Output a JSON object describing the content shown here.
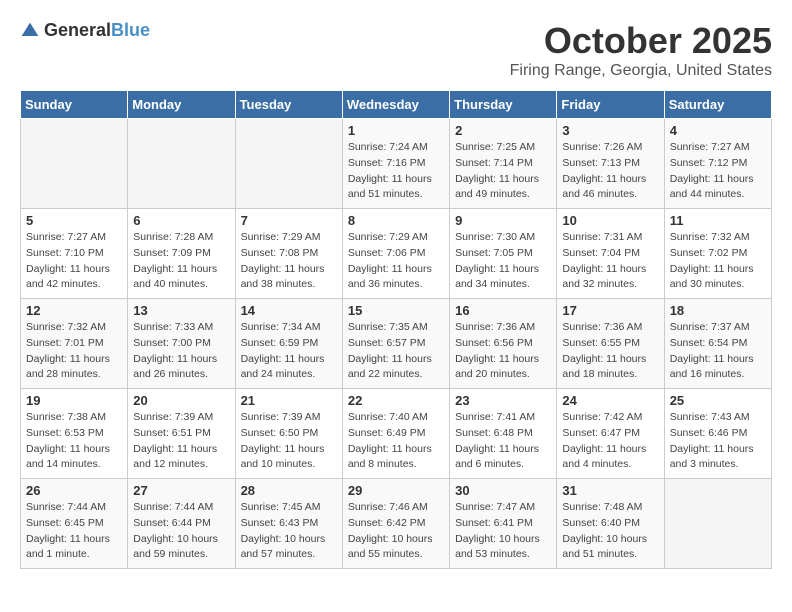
{
  "logo": {
    "general": "General",
    "blue": "Blue"
  },
  "header": {
    "month": "October 2025",
    "location": "Firing Range, Georgia, United States"
  },
  "weekdays": [
    "Sunday",
    "Monday",
    "Tuesday",
    "Wednesday",
    "Thursday",
    "Friday",
    "Saturday"
  ],
  "weeks": [
    [
      {
        "day": "",
        "sunrise": "",
        "sunset": "",
        "daylight": ""
      },
      {
        "day": "",
        "sunrise": "",
        "sunset": "",
        "daylight": ""
      },
      {
        "day": "",
        "sunrise": "",
        "sunset": "",
        "daylight": ""
      },
      {
        "day": "1",
        "sunrise": "Sunrise: 7:24 AM",
        "sunset": "Sunset: 7:16 PM",
        "daylight": "Daylight: 11 hours and 51 minutes."
      },
      {
        "day": "2",
        "sunrise": "Sunrise: 7:25 AM",
        "sunset": "Sunset: 7:14 PM",
        "daylight": "Daylight: 11 hours and 49 minutes."
      },
      {
        "day": "3",
        "sunrise": "Sunrise: 7:26 AM",
        "sunset": "Sunset: 7:13 PM",
        "daylight": "Daylight: 11 hours and 46 minutes."
      },
      {
        "day": "4",
        "sunrise": "Sunrise: 7:27 AM",
        "sunset": "Sunset: 7:12 PM",
        "daylight": "Daylight: 11 hours and 44 minutes."
      }
    ],
    [
      {
        "day": "5",
        "sunrise": "Sunrise: 7:27 AM",
        "sunset": "Sunset: 7:10 PM",
        "daylight": "Daylight: 11 hours and 42 minutes."
      },
      {
        "day": "6",
        "sunrise": "Sunrise: 7:28 AM",
        "sunset": "Sunset: 7:09 PM",
        "daylight": "Daylight: 11 hours and 40 minutes."
      },
      {
        "day": "7",
        "sunrise": "Sunrise: 7:29 AM",
        "sunset": "Sunset: 7:08 PM",
        "daylight": "Daylight: 11 hours and 38 minutes."
      },
      {
        "day": "8",
        "sunrise": "Sunrise: 7:29 AM",
        "sunset": "Sunset: 7:06 PM",
        "daylight": "Daylight: 11 hours and 36 minutes."
      },
      {
        "day": "9",
        "sunrise": "Sunrise: 7:30 AM",
        "sunset": "Sunset: 7:05 PM",
        "daylight": "Daylight: 11 hours and 34 minutes."
      },
      {
        "day": "10",
        "sunrise": "Sunrise: 7:31 AM",
        "sunset": "Sunset: 7:04 PM",
        "daylight": "Daylight: 11 hours and 32 minutes."
      },
      {
        "day": "11",
        "sunrise": "Sunrise: 7:32 AM",
        "sunset": "Sunset: 7:02 PM",
        "daylight": "Daylight: 11 hours and 30 minutes."
      }
    ],
    [
      {
        "day": "12",
        "sunrise": "Sunrise: 7:32 AM",
        "sunset": "Sunset: 7:01 PM",
        "daylight": "Daylight: 11 hours and 28 minutes."
      },
      {
        "day": "13",
        "sunrise": "Sunrise: 7:33 AM",
        "sunset": "Sunset: 7:00 PM",
        "daylight": "Daylight: 11 hours and 26 minutes."
      },
      {
        "day": "14",
        "sunrise": "Sunrise: 7:34 AM",
        "sunset": "Sunset: 6:59 PM",
        "daylight": "Daylight: 11 hours and 24 minutes."
      },
      {
        "day": "15",
        "sunrise": "Sunrise: 7:35 AM",
        "sunset": "Sunset: 6:57 PM",
        "daylight": "Daylight: 11 hours and 22 minutes."
      },
      {
        "day": "16",
        "sunrise": "Sunrise: 7:36 AM",
        "sunset": "Sunset: 6:56 PM",
        "daylight": "Daylight: 11 hours and 20 minutes."
      },
      {
        "day": "17",
        "sunrise": "Sunrise: 7:36 AM",
        "sunset": "Sunset: 6:55 PM",
        "daylight": "Daylight: 11 hours and 18 minutes."
      },
      {
        "day": "18",
        "sunrise": "Sunrise: 7:37 AM",
        "sunset": "Sunset: 6:54 PM",
        "daylight": "Daylight: 11 hours and 16 minutes."
      }
    ],
    [
      {
        "day": "19",
        "sunrise": "Sunrise: 7:38 AM",
        "sunset": "Sunset: 6:53 PM",
        "daylight": "Daylight: 11 hours and 14 minutes."
      },
      {
        "day": "20",
        "sunrise": "Sunrise: 7:39 AM",
        "sunset": "Sunset: 6:51 PM",
        "daylight": "Daylight: 11 hours and 12 minutes."
      },
      {
        "day": "21",
        "sunrise": "Sunrise: 7:39 AM",
        "sunset": "Sunset: 6:50 PM",
        "daylight": "Daylight: 11 hours and 10 minutes."
      },
      {
        "day": "22",
        "sunrise": "Sunrise: 7:40 AM",
        "sunset": "Sunset: 6:49 PM",
        "daylight": "Daylight: 11 hours and 8 minutes."
      },
      {
        "day": "23",
        "sunrise": "Sunrise: 7:41 AM",
        "sunset": "Sunset: 6:48 PM",
        "daylight": "Daylight: 11 hours and 6 minutes."
      },
      {
        "day": "24",
        "sunrise": "Sunrise: 7:42 AM",
        "sunset": "Sunset: 6:47 PM",
        "daylight": "Daylight: 11 hours and 4 minutes."
      },
      {
        "day": "25",
        "sunrise": "Sunrise: 7:43 AM",
        "sunset": "Sunset: 6:46 PM",
        "daylight": "Daylight: 11 hours and 3 minutes."
      }
    ],
    [
      {
        "day": "26",
        "sunrise": "Sunrise: 7:44 AM",
        "sunset": "Sunset: 6:45 PM",
        "daylight": "Daylight: 11 hours and 1 minute."
      },
      {
        "day": "27",
        "sunrise": "Sunrise: 7:44 AM",
        "sunset": "Sunset: 6:44 PM",
        "daylight": "Daylight: 10 hours and 59 minutes."
      },
      {
        "day": "28",
        "sunrise": "Sunrise: 7:45 AM",
        "sunset": "Sunset: 6:43 PM",
        "daylight": "Daylight: 10 hours and 57 minutes."
      },
      {
        "day": "29",
        "sunrise": "Sunrise: 7:46 AM",
        "sunset": "Sunset: 6:42 PM",
        "daylight": "Daylight: 10 hours and 55 minutes."
      },
      {
        "day": "30",
        "sunrise": "Sunrise: 7:47 AM",
        "sunset": "Sunset: 6:41 PM",
        "daylight": "Daylight: 10 hours and 53 minutes."
      },
      {
        "day": "31",
        "sunrise": "Sunrise: 7:48 AM",
        "sunset": "Sunset: 6:40 PM",
        "daylight": "Daylight: 10 hours and 51 minutes."
      },
      {
        "day": "",
        "sunrise": "",
        "sunset": "",
        "daylight": ""
      }
    ]
  ]
}
